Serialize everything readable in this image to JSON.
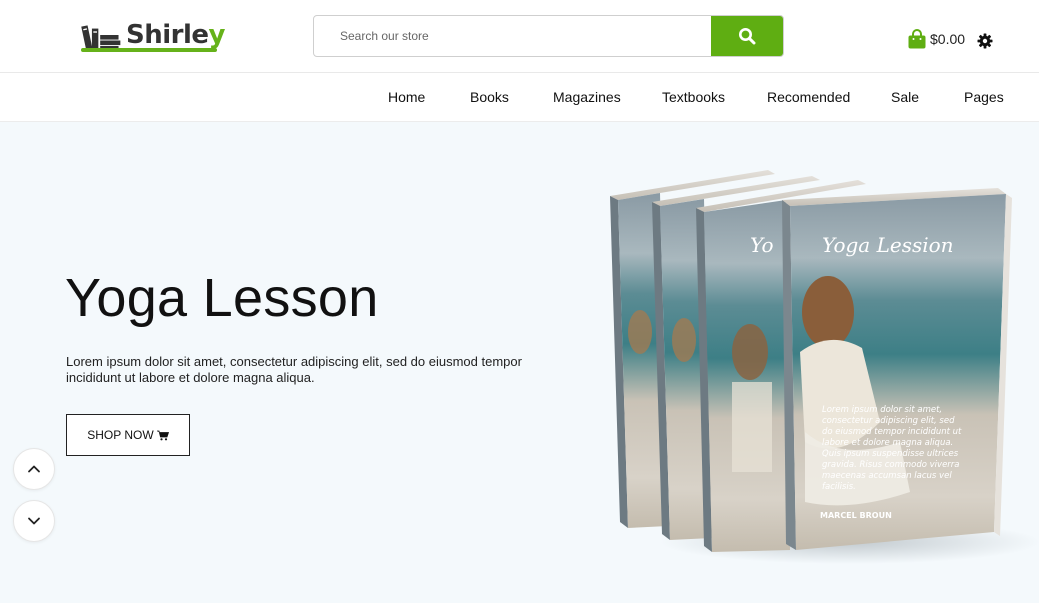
{
  "header": {
    "logo_text_main": "Shirle",
    "logo_text_accent": "y",
    "search_placeholder": "Search our store",
    "cart_amount": "$0.00"
  },
  "nav": {
    "items": [
      {
        "label": "Home"
      },
      {
        "label": "Books"
      },
      {
        "label": "Magazines"
      },
      {
        "label": "Textbooks"
      },
      {
        "label": "Recomended"
      },
      {
        "label": "Sale"
      },
      {
        "label": "Pages"
      }
    ]
  },
  "hero": {
    "title": "Yoga Lesson",
    "description": "Lorem ipsum dolor sit amet, consectetur adipiscing elit, sed do eiusmod tempor incididunt ut labore et dolore magna aliqua.",
    "button_label": "SHOP NOW",
    "book": {
      "cover_title": "Yoga Lession",
      "spine_title": "Yo",
      "cover_text": [
        "Lorem ipsum dolor sit amet,",
        "consectetur adipiscing elit, sed",
        "do eiusmod tempor incididunt ut",
        "labore et dolore magna aliqua.",
        "Quis ipsum suspendisse ultrices",
        "gravida. Risus commodo viverra",
        "maecenas accumsan lacus vel",
        "facilisis."
      ],
      "author": "MARCEL BROUN"
    }
  },
  "colors": {
    "accent": "#66b21a",
    "search_button": "#5fae12",
    "hero_background": "#f4f9fc"
  },
  "icons": {
    "logo": "books-icon",
    "search": "search-icon",
    "cart": "shopping-bag-icon",
    "settings": "gear-icon",
    "shop": "cart-icon",
    "slide_up": "chevron-up-icon",
    "slide_down": "chevron-down-icon"
  }
}
